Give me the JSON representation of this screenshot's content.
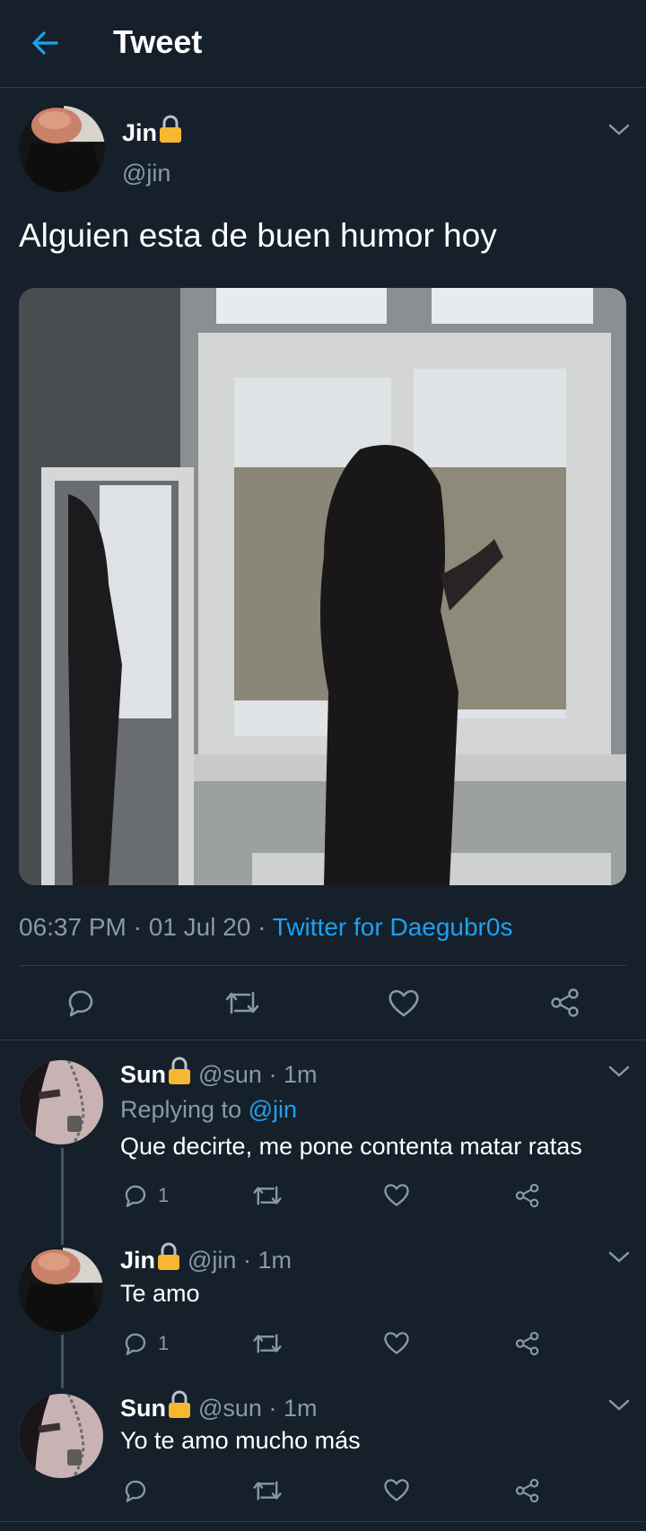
{
  "header": {
    "title": "Tweet",
    "back_icon": "arrow-left-icon"
  },
  "colors": {
    "background": "#15202b",
    "accent": "#1da1f2",
    "muted": "#8899a6",
    "divider": "#2f3d4a",
    "lock": "#f7b731"
  },
  "tweet": {
    "author_name": "Jin",
    "author_handle": "@jin",
    "text": "Alguien esta de buen humor hoy",
    "time": "06:37 PM",
    "date": "01 Jul 20",
    "source": "Twitter for Daegubr0s",
    "sep": " · "
  },
  "replies": [
    {
      "name": "Sun",
      "handle": "@sun",
      "time": "1m",
      "replying_prefix": "Replying to ",
      "replying_to": "@jin",
      "text": "Que decirte, me pone contenta matar ratas",
      "reply_count": "1"
    },
    {
      "name": "Jin",
      "handle": "@jin",
      "time": "1m",
      "text": "Te amo",
      "reply_count": "1"
    },
    {
      "name": "Sun",
      "handle": "@sun",
      "time": "1m",
      "text": "Yo te amo mucho más",
      "reply_count": ""
    }
  ]
}
